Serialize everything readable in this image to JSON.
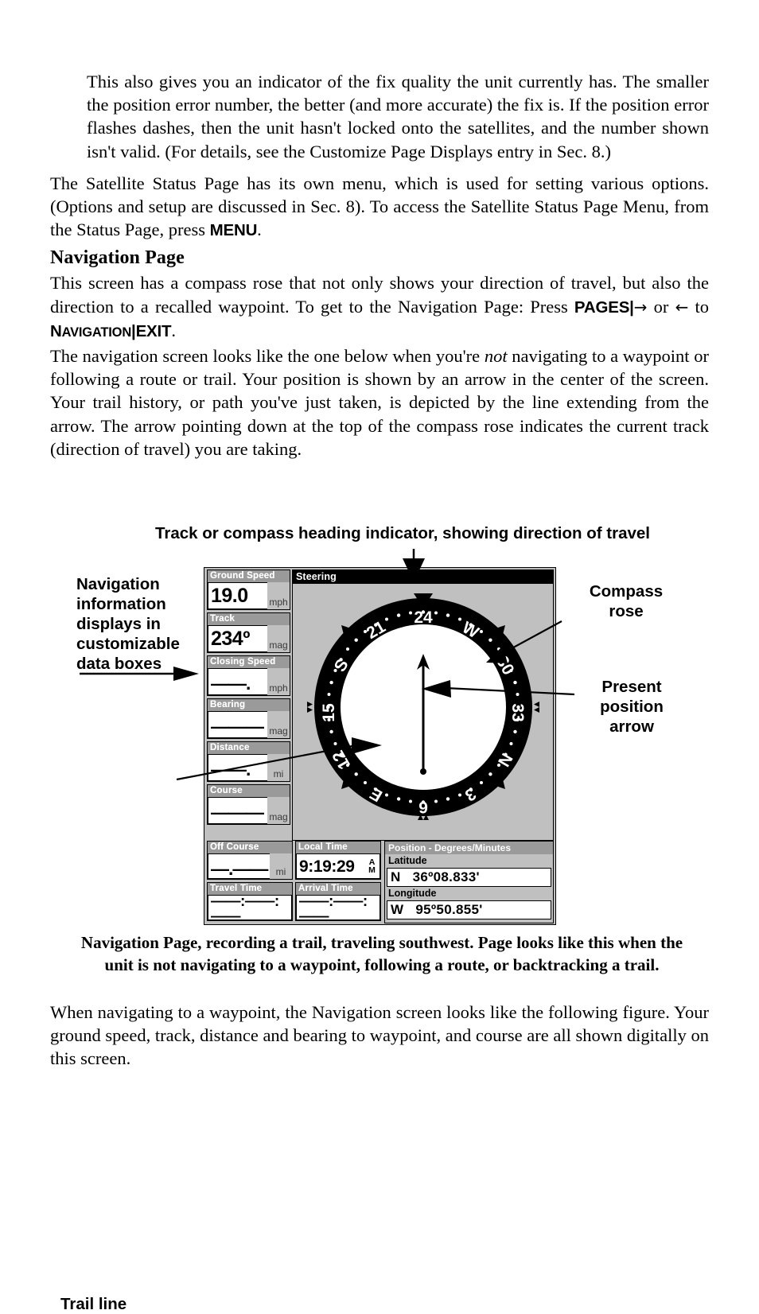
{
  "document": {
    "paragraphs": [
      {
        "id": "p1",
        "indented": true,
        "text": "This also gives you an indicator of the fix quality the unit currently has. The smaller the position error number, the better (and more accurate) the fix is. If the position error flashes dashes, then the unit hasn't locked onto the satellites, and the number shown isn't valid. (For details, see the Customize Page Displays entry in Sec. 8.)"
      },
      {
        "id": "p2",
        "indented": false,
        "text_before_bold": "The Satellite Status Page has its own menu, which is used for setting various options. (Options and setup are discussed in Sec. 8). To access the Satellite Status Page Menu, from the Status Page, press ",
        "bold_key": "MENU",
        "text_after_bold": "."
      }
    ],
    "heading": "Navigation Page",
    "p3_part1": "This screen has a compass rose that not only shows your direction of travel, but also the direction to a recalled waypoint. To get to the Navigation Page: Press ",
    "p3_key1": "PAGES",
    "p3_sep1": "|",
    "p3_arrow_right": "→",
    "p3_or": " or ",
    "p3_arrow_left": "←",
    "p3_to": " to ",
    "p3_key2_cap": "N",
    "p3_key2_rest": "AVIGATION",
    "p3_sep2": "|",
    "p3_key3": "EXIT",
    "p3_end": ".",
    "p4_a": "The navigation screen looks like the one below when you're ",
    "p4_italic": "not",
    "p4_b": " navigating to a waypoint or following a route or trail. Your position is shown by an arrow in the center of the screen. Your trail history, or path you've just taken, is depicted by the line extending from the arrow. The arrow pointing down at the top of the compass rose indicates the current track (direction of travel) you are taking.",
    "caption": "Navigation Page, recording a trail, traveling southwest. Page looks like this when the unit is not navigating to a waypoint, following a route, or backtracking a trail.",
    "closing": "When navigating to a waypoint, the Navigation screen looks like the following figure. Your ground speed, track, distance and bearing to waypoint, and course are all shown digitally on this screen."
  },
  "figure": {
    "callouts": {
      "top": "Track or compass heading indicator, showing direction of travel",
      "left": "Navigation\ninformation\ndisplays in\ncustomizable\ndata boxes",
      "compass_rose": "Compass\nrose",
      "present_position": "Present\nposition\narrow",
      "trail_line": "Trail line"
    },
    "gps": {
      "steering_title": "Steering",
      "data_boxes_left": [
        {
          "title": "Ground Speed",
          "value": "19.0",
          "unit": "mph",
          "dashed": false
        },
        {
          "title": "Track",
          "value": "234º",
          "unit": "mag",
          "dashed": false
        },
        {
          "title": "Closing Speed",
          "value": "——.——",
          "unit": "mph",
          "dashed": true
        },
        {
          "title": "Bearing",
          "value": "———º",
          "unit": "mag",
          "dashed": true
        },
        {
          "title": "Distance",
          "value": "——.——",
          "unit": "mi",
          "dashed": true
        },
        {
          "title": "Course",
          "value": "———º",
          "unit": "mag",
          "dashed": true
        }
      ],
      "bottom_col1": [
        {
          "title": "Off Course",
          "value": "—.——",
          "unit": "mi"
        },
        {
          "title": "Travel Time",
          "value": "——:——:——",
          "unit": ""
        }
      ],
      "bottom_col2": [
        {
          "title": "Local Time",
          "value": "9:19:29",
          "ampm_a": "A",
          "ampm_m": "M"
        },
        {
          "title": "Arrival Time",
          "value": "——:——:——"
        }
      ],
      "position": {
        "title": "Position  -  Degrees/Minutes",
        "latitude_label": "Latitude",
        "latitude_value": "N   36º08.833'",
        "longitude_label": "Longitude",
        "longitude_value": "W   95º50.855'"
      },
      "compass": {
        "heading_top_label": "24",
        "ring_labels": [
          "24",
          "W",
          "30",
          "33",
          "N",
          "3",
          "6",
          "E",
          "12",
          "15",
          "S",
          "21"
        ],
        "track_degrees": 234,
        "background_color": "#c0c0c0",
        "ring_color": "#000000",
        "inner_color": "#ffffff"
      }
    }
  }
}
